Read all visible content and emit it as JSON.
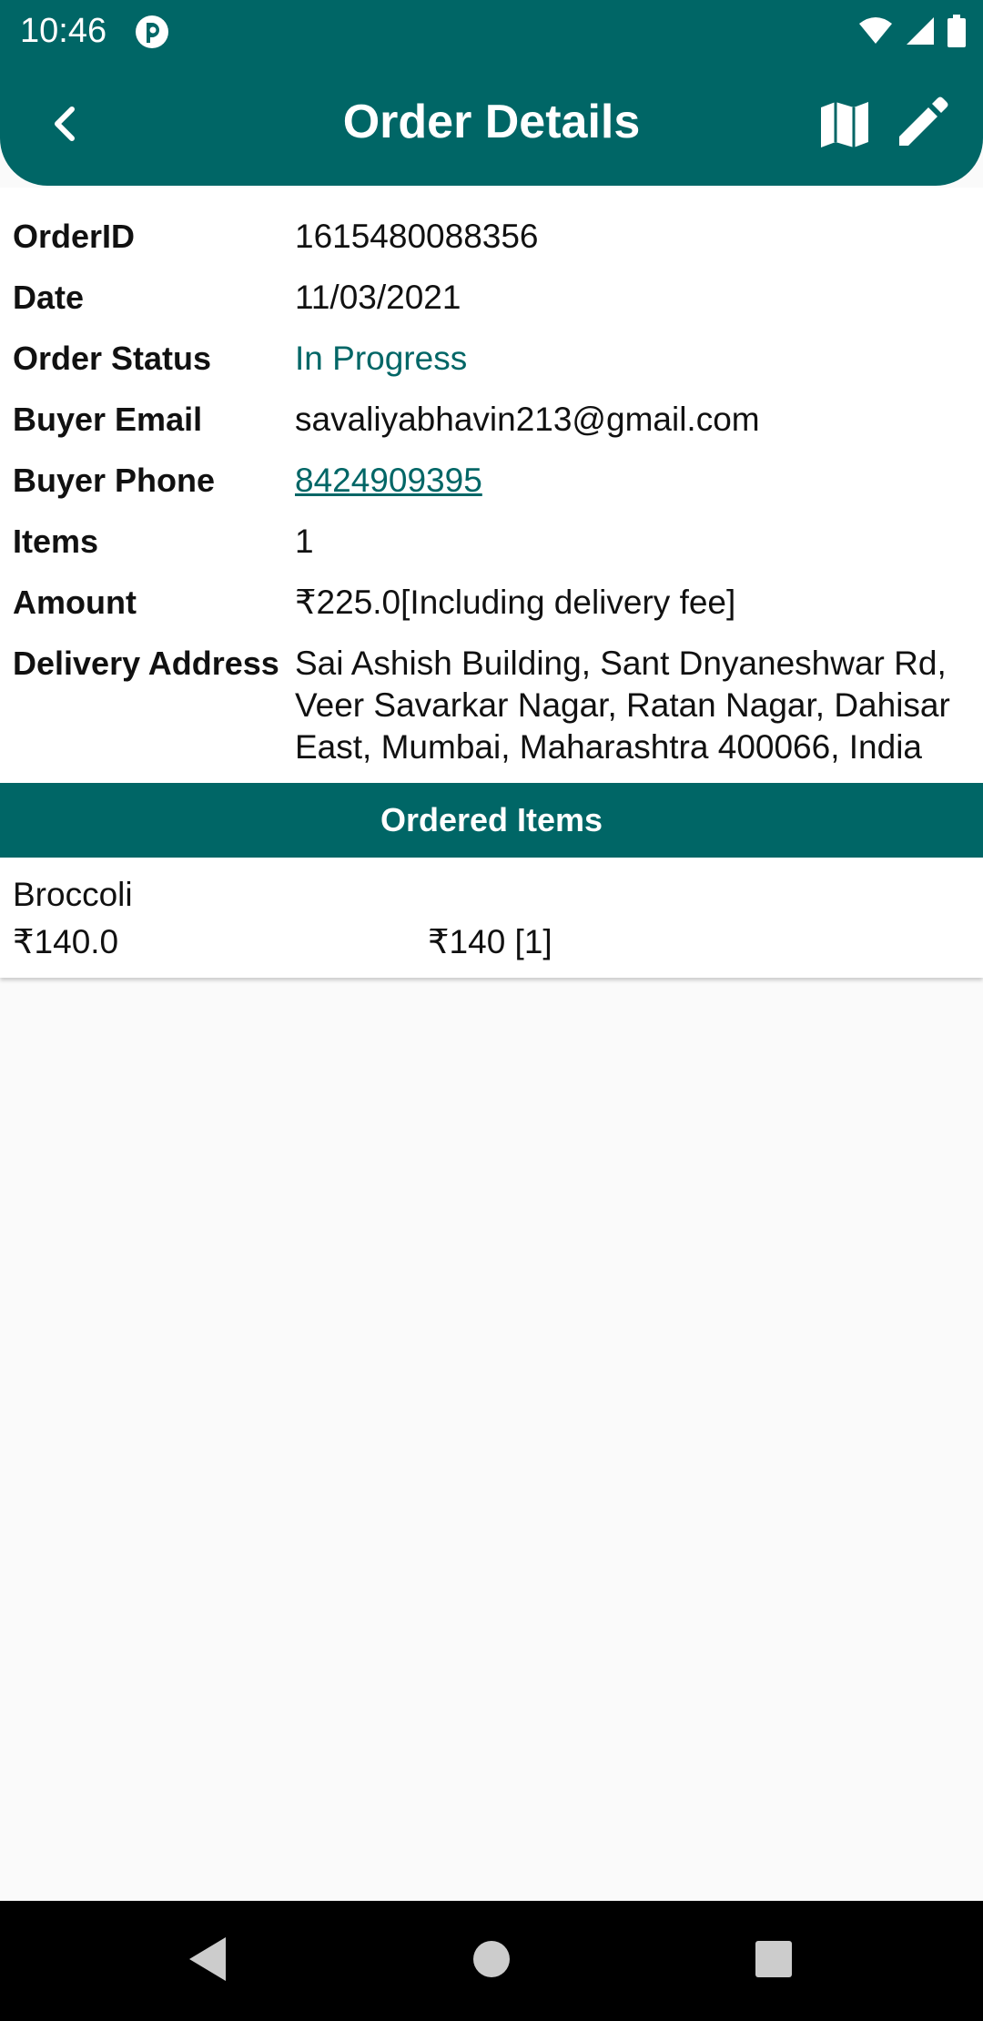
{
  "status_bar": {
    "time": "10:46",
    "icons": [
      "app-notification-icon",
      "wifi-icon",
      "signal-icon",
      "battery-icon"
    ]
  },
  "header": {
    "title": "Order Details",
    "back_icon": "chevron-left-icon",
    "actions": [
      "map-icon",
      "edit-icon"
    ]
  },
  "order": {
    "rows": [
      {
        "label": "OrderID",
        "value": "1615480088356"
      },
      {
        "label": "Date",
        "value": "11/03/2021"
      },
      {
        "label": "Order Status",
        "value": "In Progress"
      },
      {
        "label": "Buyer Email",
        "value": "savaliyabhavin213@gmail.com"
      },
      {
        "label": "Buyer Phone",
        "value": "8424909395"
      },
      {
        "label": "Items",
        "value": "1"
      },
      {
        "label": "Amount",
        "value": "₹225.0[Including delivery fee]"
      },
      {
        "label": "Delivery Address",
        "value": "Sai Ashish Building, Sant Dnyaneshwar Rd, Veer Savarkar Nagar, Ratan Nagar, Dahisar East, Mumbai, Maharashtra 400066, India"
      }
    ]
  },
  "ordered_items": {
    "heading": "Ordered Items",
    "items": [
      {
        "name": "Broccoli",
        "price": "₹140.0",
        "total": "₹140 [1]"
      }
    ]
  },
  "colors": {
    "primary": "#006666",
    "background": "#fafafa",
    "card": "#ffffff"
  }
}
